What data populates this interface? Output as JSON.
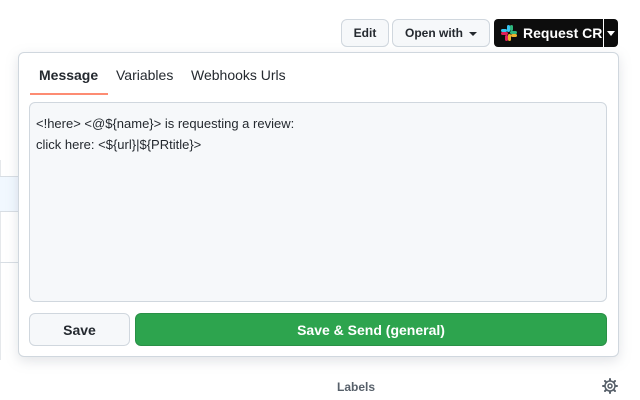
{
  "toolbar": {
    "edit_label": "Edit",
    "open_with_label": "Open with",
    "request_label": "Request CR",
    "request_icon": "slack-icon"
  },
  "popover": {
    "tabs": [
      {
        "label": "Message",
        "active": true
      },
      {
        "label": "Variables",
        "active": false
      },
      {
        "label": "Webhooks Urls",
        "active": false
      }
    ],
    "message_lines": [
      "<!here> <@${name}> is requesting a review:",
      "click here: <${url}|${PRtitle}>"
    ],
    "save_label": "Save",
    "send_label": "Save & Send (general)"
  },
  "background": {
    "labels_heading": "Labels",
    "settings_icon": "gear-icon"
  },
  "colors": {
    "send_green": "#2da44e",
    "tab_underline": "#fd8c73",
    "request_bg": "#0d0d0d"
  }
}
